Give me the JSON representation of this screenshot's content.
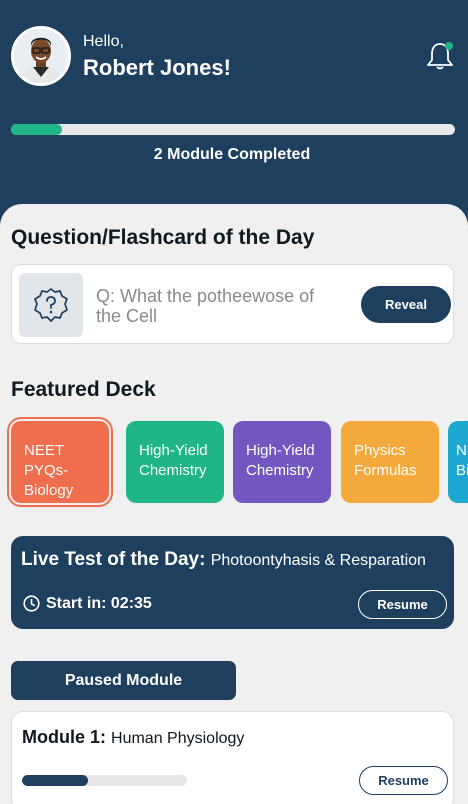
{
  "header": {
    "greeting": "Hello,",
    "user_name": "Robert Jones!",
    "progress_fraction": 0.115,
    "progress_label": "2 Module Completed"
  },
  "question_of_day": {
    "title": "Question/Flashcard of the Day",
    "question": "Q: What the potheewose of the Cell",
    "reveal_label": "Reveal"
  },
  "featured": {
    "title": "Featured Deck",
    "decks": [
      {
        "line1": "NEET PYQs-",
        "line2": "Biology",
        "color": "#ef6e4e"
      },
      {
        "line1": "High-Yield",
        "line2": "Chemistry",
        "color": "#20b587"
      },
      {
        "line1": "High-Yield",
        "line2": "Chemistry",
        "color": "#7257c0"
      },
      {
        "line1": "Physics",
        "line2": "Formulas",
        "color": "#f3a93c"
      },
      {
        "line1": "N",
        "line2": "Bi",
        "color": "#1ea8cf"
      }
    ]
  },
  "live_test": {
    "title": "Live Test of the Day:",
    "subtitle": "Photoontyhasis & Resparation",
    "start_text": "Start in: 02:35",
    "resume_label": "Resume"
  },
  "paused": {
    "button_label": "Paused Module",
    "module_title": "Module 1:",
    "module_name": "Human Physiology",
    "progress_fraction": 0.4,
    "resume_label": "Resume"
  },
  "colors": {
    "primary": "#1f3f5f",
    "accent": "#20b587",
    "background": "#f0f0f0"
  }
}
